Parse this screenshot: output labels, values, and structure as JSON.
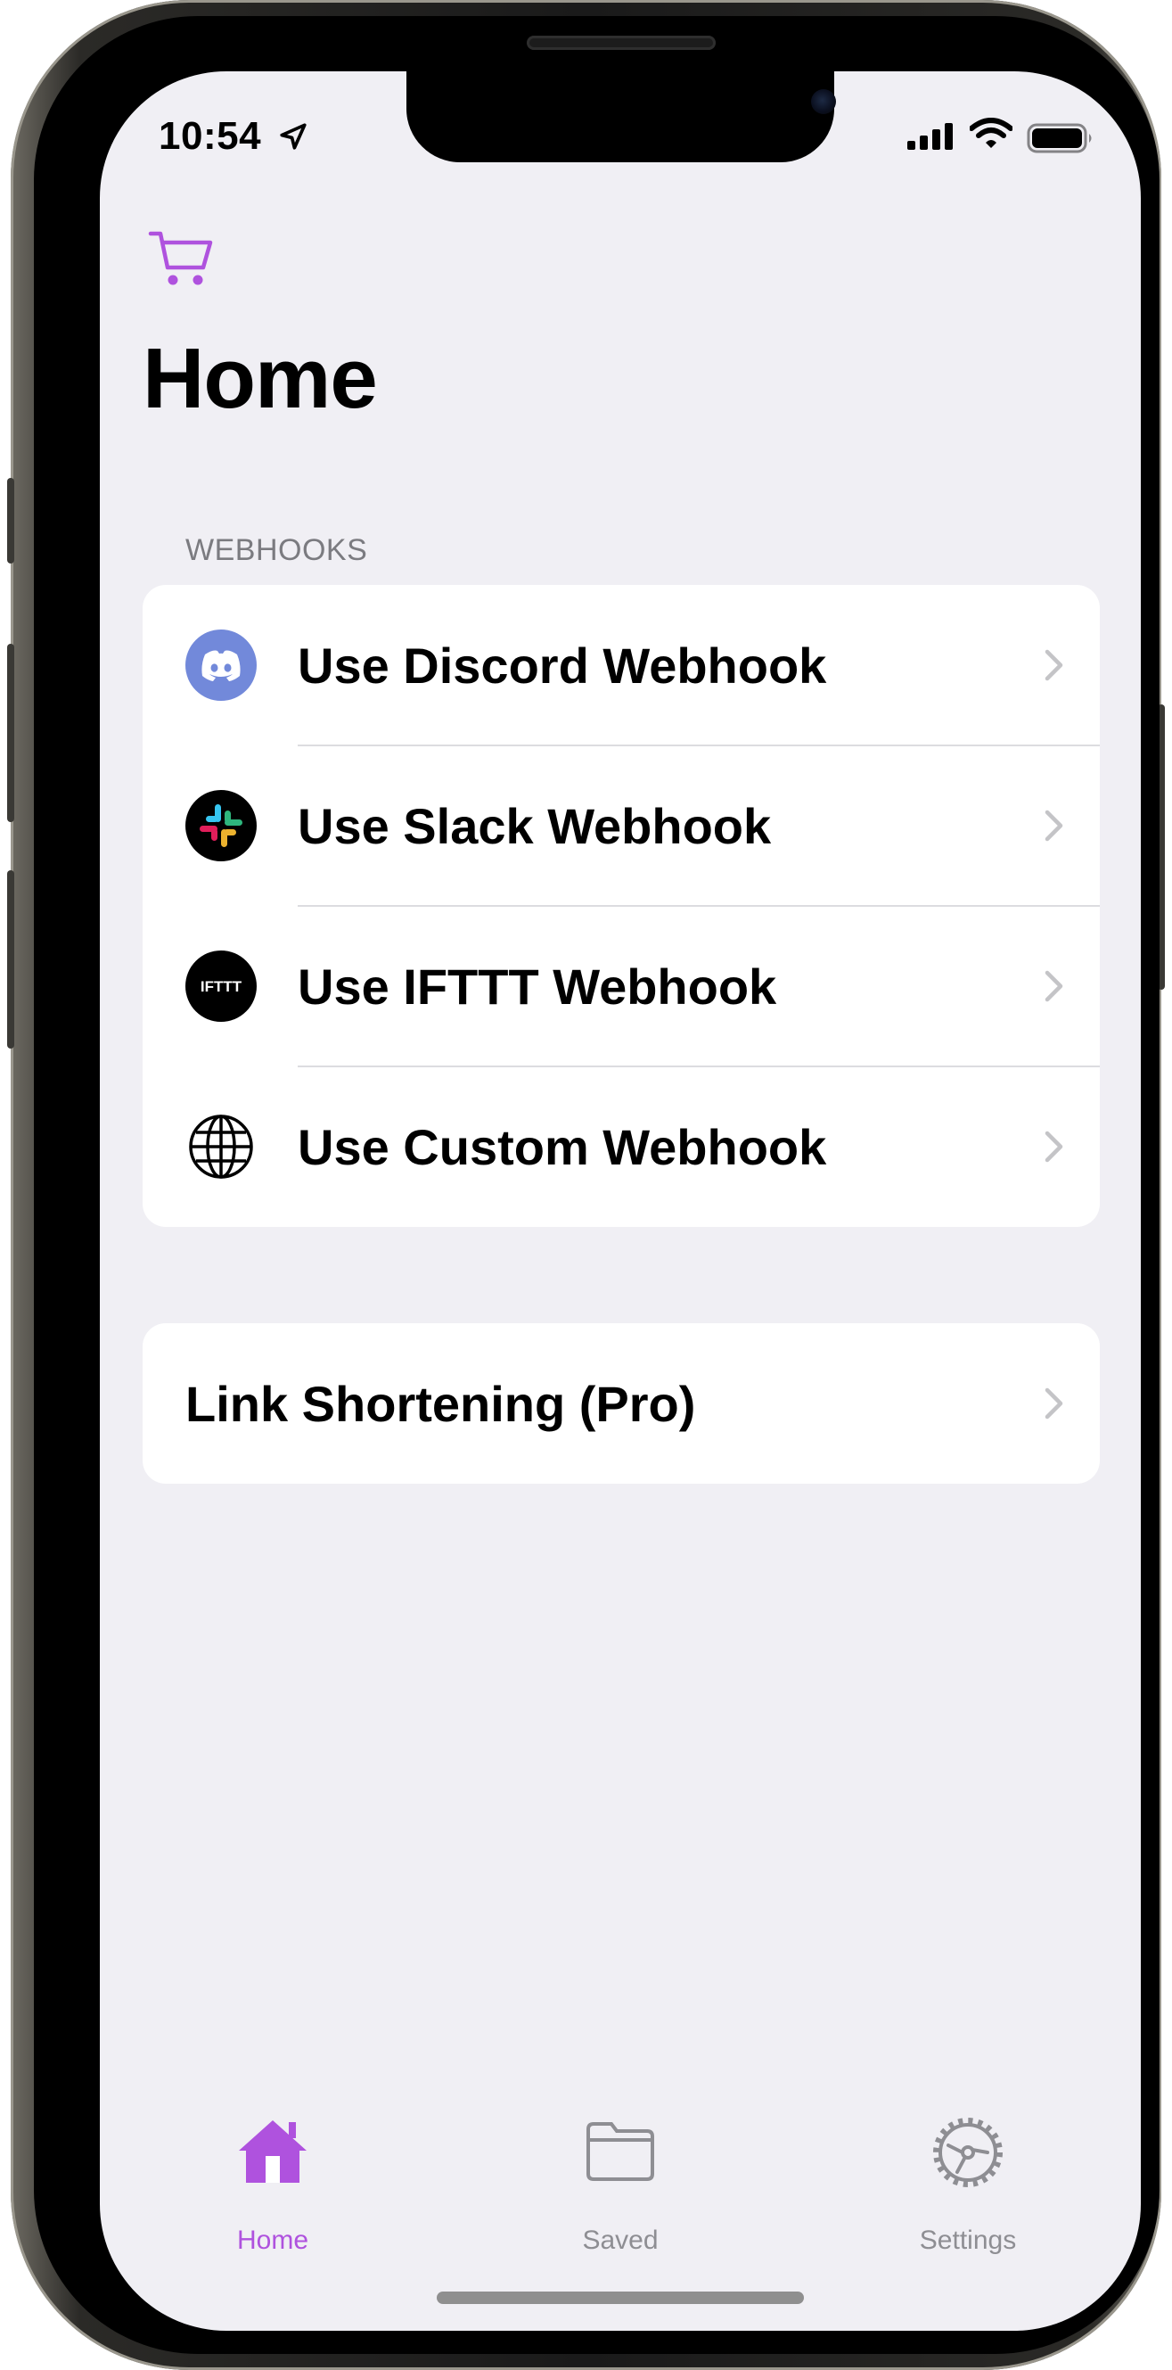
{
  "status_bar": {
    "time": "10:54"
  },
  "page": {
    "title": "Home"
  },
  "webhooks": {
    "header": "WEBHOOKS",
    "items": [
      {
        "label": "Use Discord Webhook",
        "icon": "discord-icon"
      },
      {
        "label": "Use Slack Webhook",
        "icon": "slack-icon"
      },
      {
        "label": "Use IFTTT Webhook",
        "icon": "ifttt-icon",
        "icon_text": "IFTTT"
      },
      {
        "label": "Use Custom Webhook",
        "icon": "globe-icon"
      }
    ]
  },
  "extras": {
    "link_shortening": "Link Shortening (Pro)"
  },
  "tab_bar": {
    "tabs": [
      {
        "label": "Home",
        "icon": "house-icon",
        "active": true
      },
      {
        "label": "Saved",
        "icon": "folder-icon",
        "active": false
      },
      {
        "label": "Settings",
        "icon": "gear-icon",
        "active": false
      }
    ]
  },
  "colors": {
    "accent": "#af52de",
    "inactive": "#8e8e93",
    "background": "#f0eff4"
  }
}
